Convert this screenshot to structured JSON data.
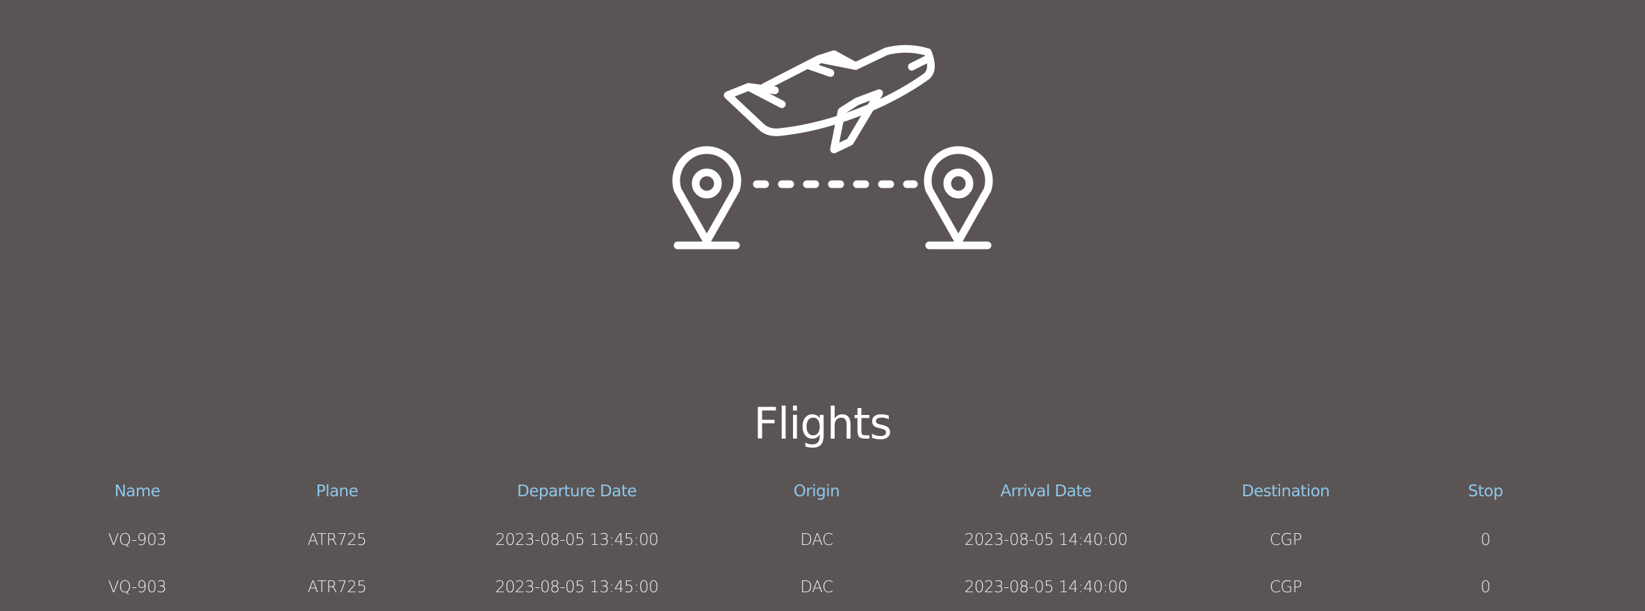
{
  "page": {
    "title": "Flights"
  },
  "hero_icon": "airplane-route-icon",
  "table": {
    "headers": [
      "Name",
      "Plane",
      "Departure Date",
      "Origin",
      "Arrival Date",
      "Destination",
      "Stop"
    ],
    "rows": [
      [
        "VQ-903",
        "ATR725",
        "2023-08-05 13:45:00",
        "DAC",
        "2023-08-05 14:40:00",
        "CGP",
        "0"
      ],
      [
        "VQ-903",
        "ATR725",
        "2023-08-05 13:45:00",
        "DAC",
        "2023-08-05 14:40:00",
        "CGP",
        "0"
      ]
    ]
  },
  "colors": {
    "background": "#5b5454",
    "header_text": "#8cc8ec",
    "body_text": "#f4f1f1"
  }
}
